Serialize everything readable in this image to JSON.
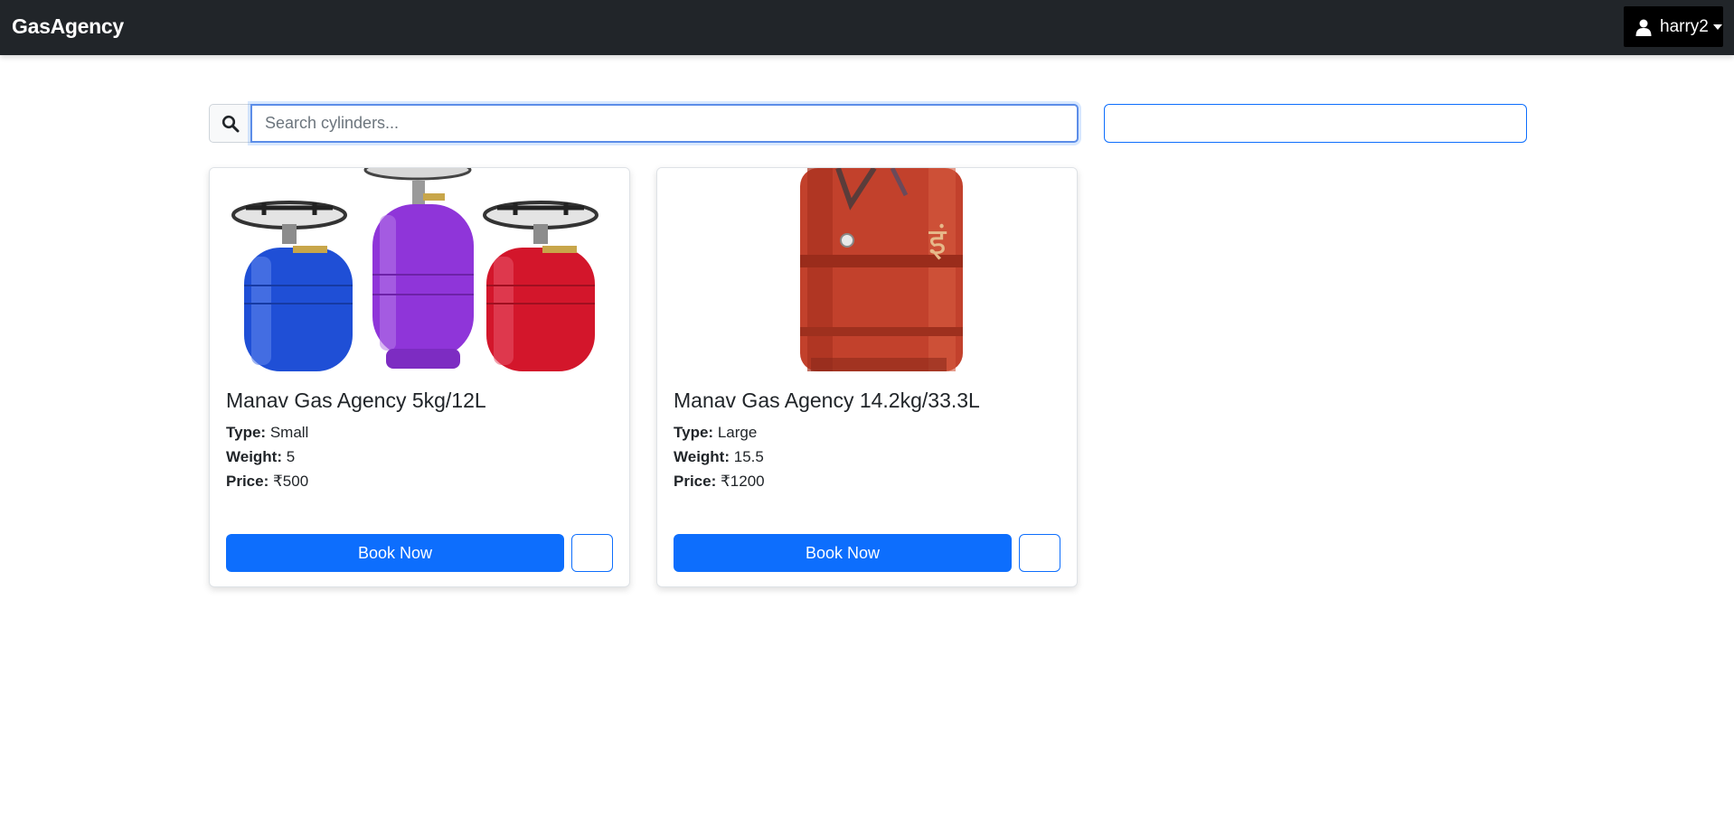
{
  "navbar": {
    "brand": "GasAgency",
    "user": {
      "icon": "user-icon",
      "name": "harry2",
      "caret_icon": "caret-down-icon"
    }
  },
  "search": {
    "icon": "search-icon",
    "placeholder": "Search cylinders...",
    "value": ""
  },
  "filter_box": {
    "value": ""
  },
  "accent_color": "#0d6efd",
  "navbar_color": "#212529",
  "products": [
    {
      "title": "Manav Gas Agency 5kg/12L",
      "type_label": "Type:",
      "type": "Small",
      "weight_label": "Weight:",
      "weight": "5",
      "price_label": "Price:",
      "price": "₹500",
      "book_label": "Book Now",
      "image": "three-small-gas-cylinders-with-burners"
    },
    {
      "title": "Manav Gas Agency 14.2kg/33.3L",
      "type_label": "Type:",
      "type": "Large",
      "weight_label": "Weight:",
      "weight": "15.5",
      "price_label": "Price:",
      "price": "₹1200",
      "book_label": "Book Now",
      "image": "red-lpg-cylinder"
    }
  ]
}
